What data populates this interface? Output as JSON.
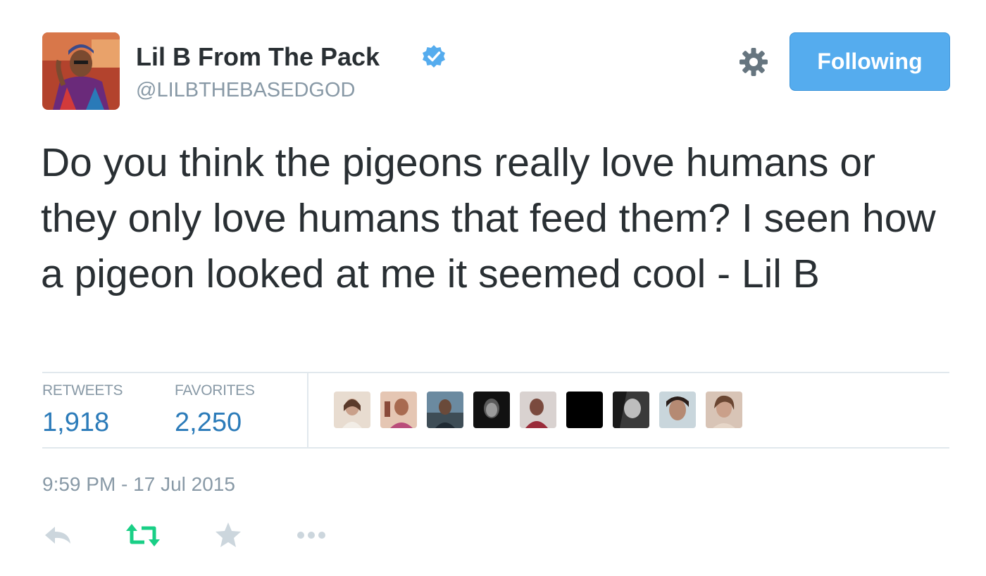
{
  "user": {
    "display_name": "Lil B From The Pack",
    "handle": "@LILBTHEBASEDGOD",
    "verified": true,
    "avatar_icon": "user-avatar"
  },
  "header": {
    "settings_icon": "gear-icon",
    "follow_button_label": "Following"
  },
  "tweet": {
    "text": "Do you think the pigeons really love humans or they only love humans that feed them? I seen how a pigeon looked at me it seemed cool - Lil B",
    "timestamp": "9:59 PM - 17 Jul 2015"
  },
  "stats": {
    "retweets_label": "RETWEETS",
    "retweets_count": "1,918",
    "favorites_label": "FAVORITES",
    "favorites_count": "2,250"
  },
  "favoriters": {
    "count_shown": 9
  },
  "actions": {
    "reply_icon": "reply-icon",
    "retweet_icon": "retweet-icon",
    "favorite_icon": "star-icon",
    "more_icon": "more-icon"
  },
  "colors": {
    "accent": "#55acee",
    "link": "#2b7bb9",
    "muted": "#8899a6",
    "text": "#292f33",
    "retweet_active": "#19cf86",
    "divider": "#e1e8ed"
  }
}
